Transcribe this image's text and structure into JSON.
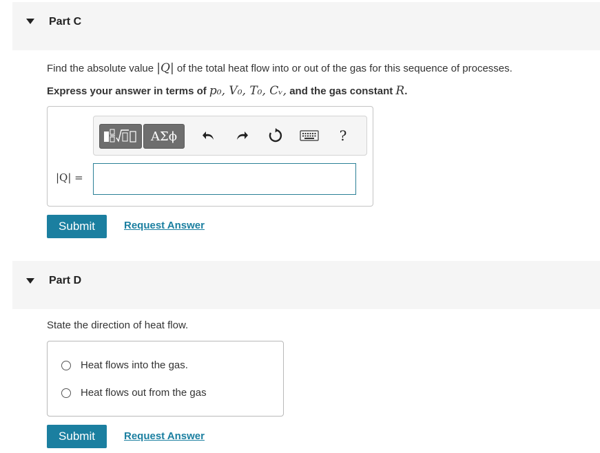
{
  "part_c": {
    "title": "Part C",
    "question_pre": "Find the absolute value ",
    "question_var": "|Q|",
    "question_post": " of the total heat flow into or out of the gas for this sequence of processes.",
    "instruction_pre": "Express your answer in terms of ",
    "instruction_vars": "p₀, V₀, T₀, Cᵥ,",
    "instruction_mid": " and the gas constant ",
    "instruction_const": "R",
    "instruction_end": ".",
    "toolbar": {
      "templates_icon": "fraction-sqrt-template-icon",
      "greek_label": "ΑΣϕ",
      "undo_icon": "undo-icon",
      "redo_icon": "redo-icon",
      "reset_icon": "reset-icon",
      "keyboard_icon": "keyboard-icon",
      "help_label": "?"
    },
    "answer_label": "|Q| =",
    "answer_value": "",
    "submit_label": "Submit",
    "request_label": "Request Answer"
  },
  "part_d": {
    "title": "Part D",
    "question": "State the direction of heat flow.",
    "choices": [
      {
        "label": "Heat flows into the gas.",
        "selected": false
      },
      {
        "label": "Heat flows out from the gas",
        "selected": false
      }
    ],
    "submit_label": "Submit",
    "request_label": "Request Answer"
  },
  "colors": {
    "accent": "#1b7fa0",
    "header_bg": "#f5f5f5",
    "toolbar_button": "#6e6e6e"
  }
}
